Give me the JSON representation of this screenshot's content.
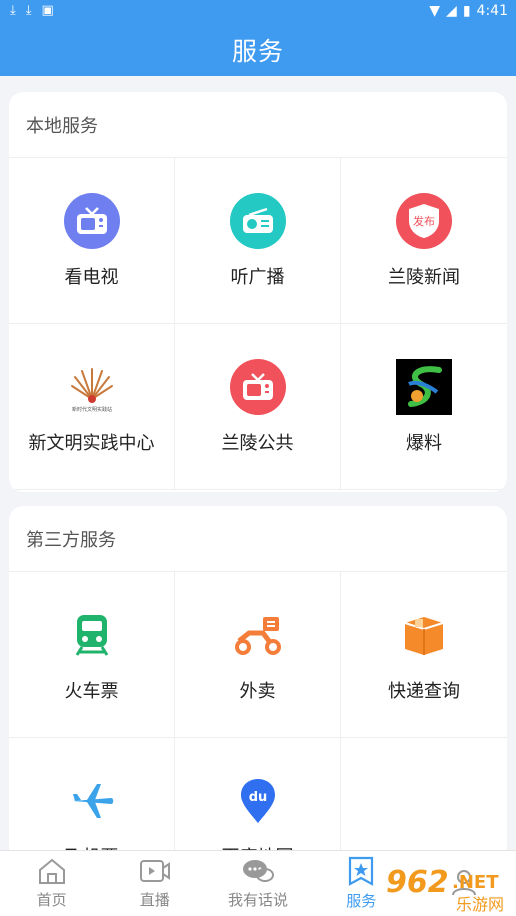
{
  "status": {
    "time": "4:41"
  },
  "header": {
    "title": "服务"
  },
  "local": {
    "title": "本地服务",
    "items": [
      {
        "label": "看电视",
        "icon": "tv-icon",
        "color": "#6f7ff0"
      },
      {
        "label": "听广播",
        "icon": "radio-icon",
        "color": "#25c9c3"
      },
      {
        "label": "兰陵新闻",
        "icon": "publish-shield-icon",
        "color": "#f0515a",
        "badge": "发布"
      },
      {
        "label": "新文明实践中心",
        "icon": "civilization-center-logo",
        "logo_text": "新时代文明实践站"
      },
      {
        "label": "兰陵公共",
        "icon": "tv-public-icon",
        "color": "#f0515a"
      },
      {
        "label": "爆料",
        "icon": "report-logo"
      }
    ]
  },
  "third": {
    "title": "第三方服务",
    "items": [
      {
        "label": "火车票",
        "icon": "train-icon",
        "color": "#1fb36b"
      },
      {
        "label": "外卖",
        "icon": "scooter-icon",
        "color": "#f47d3a"
      },
      {
        "label": "快递查询",
        "icon": "parcel-icon",
        "color": "#f48a2a"
      },
      {
        "label": "飞机票",
        "icon": "airplane-icon",
        "color": "#3aa3ea"
      },
      {
        "label": "百度地图",
        "icon": "baidu-map-icon",
        "color": "#2f6ff0",
        "badge": "du"
      }
    ]
  },
  "tabs": [
    {
      "label": "首页",
      "icon": "home-icon"
    },
    {
      "label": "直播",
      "icon": "video-icon"
    },
    {
      "label": "我有话说",
      "icon": "chat-icon"
    },
    {
      "label": "服务",
      "icon": "service-star-icon",
      "active": true
    },
    {
      "label": "",
      "icon": "profile-icon"
    }
  ],
  "watermark": {
    "text": "962",
    "suffix": ".NET",
    "sub": "乐游网"
  }
}
